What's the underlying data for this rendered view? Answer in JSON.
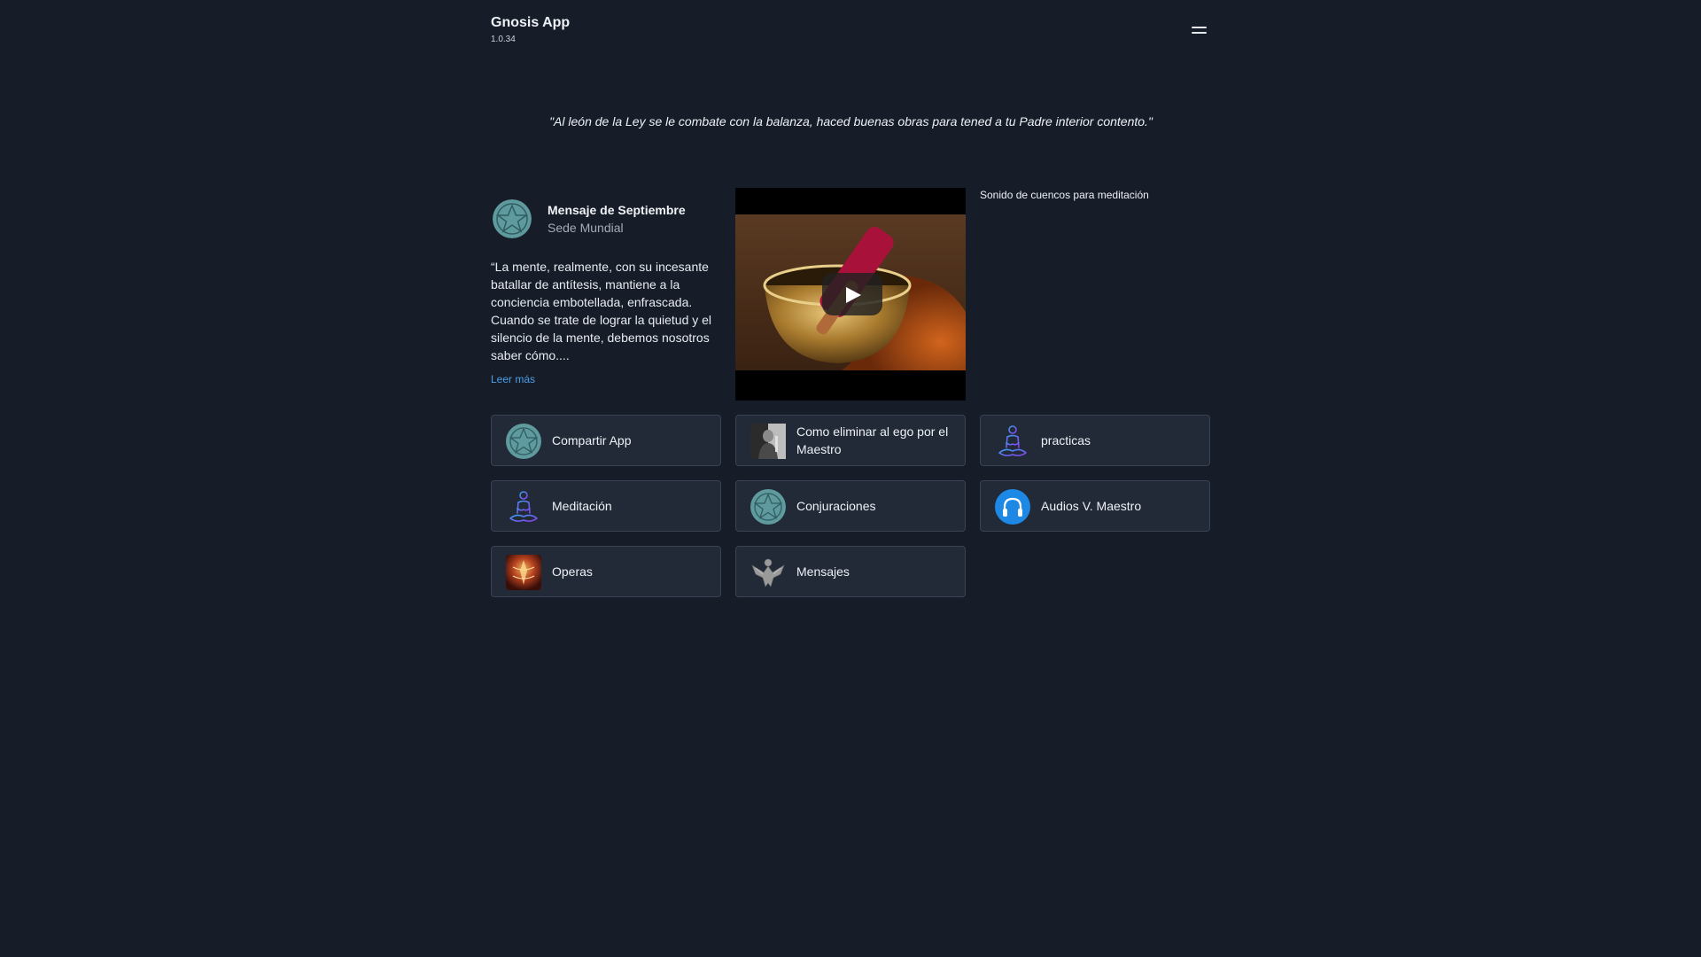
{
  "header": {
    "title": "Gnosis App",
    "version": "1.0.34",
    "menu_icon": "hamburger-menu-icon"
  },
  "quote": "\"Al león de la Ley se le combate con la balanza, haced buenas obras para tened a tu Padre interior contento.\"",
  "message": {
    "title": "Mensaje de Septiembre",
    "subtitle": "Sede Mundial",
    "body": "“La mente, realmente, con su incesante batallar de antítesis, mantiene a la conciencia embotellada, enfrascada. Cuando se trate de lograr la quietud y el silencio de la mente, debemos nosotros saber cómo....",
    "more_link": "Leer más",
    "avatar_icon": "pentagram-icon"
  },
  "video": {
    "thumbnail_icon": "singing-bowl-thumbnail",
    "play_icon": "play-icon"
  },
  "audio_title": "Sonido de cuencos para meditación",
  "tiles": [
    {
      "label": "Compartir App",
      "icon": "pentagram-icon"
    },
    {
      "label": "Como eliminar al ego por el Maestro",
      "icon": "master-photo-icon"
    },
    {
      "label": "practicas",
      "icon": "meditation-figure-icon"
    },
    {
      "label": "Meditación",
      "icon": "meditation-figure-icon"
    },
    {
      "label": "Conjuraciones",
      "icon": "pentagram-icon"
    },
    {
      "label": "Audios V. Maestro",
      "icon": "headphones-icon"
    },
    {
      "label": "Operas",
      "icon": "opera-art-icon"
    },
    {
      "label": "Mensajes",
      "icon": "eagle-emblem-icon"
    }
  ],
  "colors": {
    "background": "#161d29",
    "tile_background": "#222a38",
    "tile_border": "#3a4354",
    "link": "#4d9de6",
    "icon_teal": "#5e9a9e",
    "headphones_blue": "#1e88e5"
  }
}
